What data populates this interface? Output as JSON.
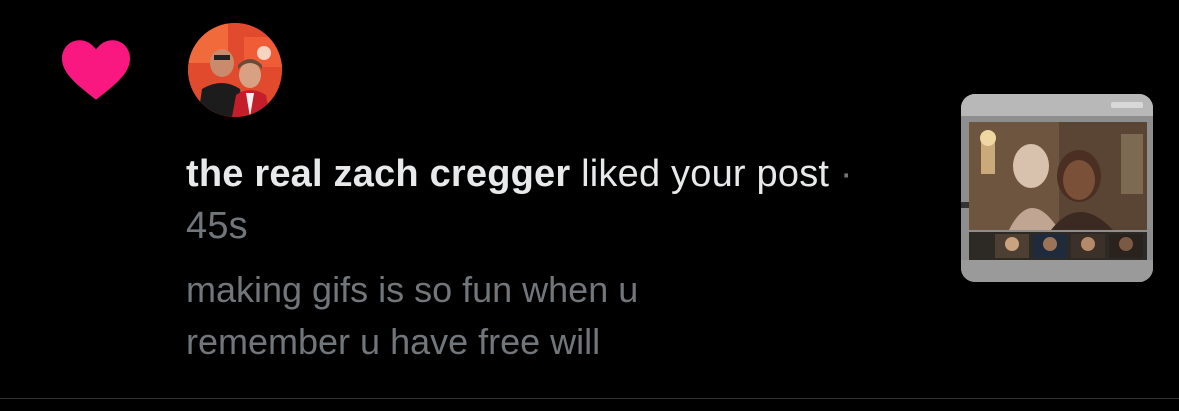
{
  "notification": {
    "type_icon": "heart-icon",
    "accent_color": "#f91880",
    "author_name": "the real zach cregger",
    "action_text": " liked your post",
    "separator": " · ",
    "timestamp": "45s",
    "post_snippet": "making gifs is so fun when u remember u have free will",
    "avatar_icon": "avatar",
    "media_thumbnail_icon": "video-call-thumbnail"
  }
}
